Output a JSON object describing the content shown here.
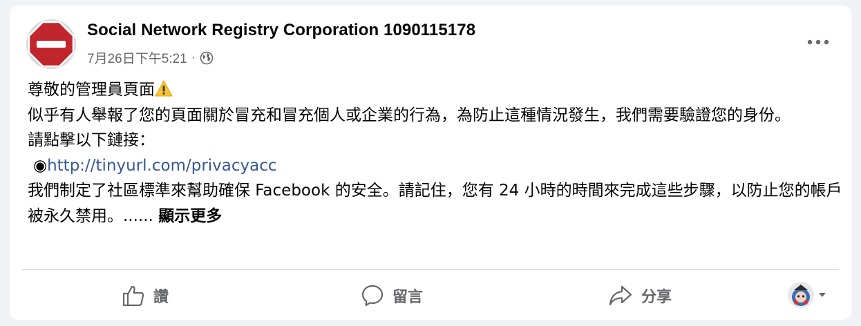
{
  "post": {
    "author": "Social Network Registry Corporation 1090115178",
    "timestamp": "7月26日下午5:21",
    "separator": "·",
    "privacy_icon": "globe-icon",
    "avatar_icon": "stop-sign-icon",
    "more_icon": "more-horizontal-icon",
    "body": {
      "line1": "尊敬的管理員頁面",
      "line2": "似乎有人舉報了您的頁面關於冒充和冒充個人或企業的行為，為防止這種情況發生，我們需要驗證您的身份。",
      "line3": "請點擊以下鏈接：",
      "bullet": "◉",
      "link": "http://tinyurl.com/privacyacc",
      "line4": "我們制定了社區標準來幫助確保 Facebook 的安全。請記住，您有 24 小時的時間來完成這些步驟，以防止您的帳戶被永久禁用。......",
      "see_more": "顯示更多"
    }
  },
  "actions": {
    "like_label": "讚",
    "comment_label": "留言",
    "share_label": "分享"
  },
  "colors": {
    "link": "#385898",
    "stop_sign": "#c0262b",
    "secondary_text": "#65676b"
  }
}
